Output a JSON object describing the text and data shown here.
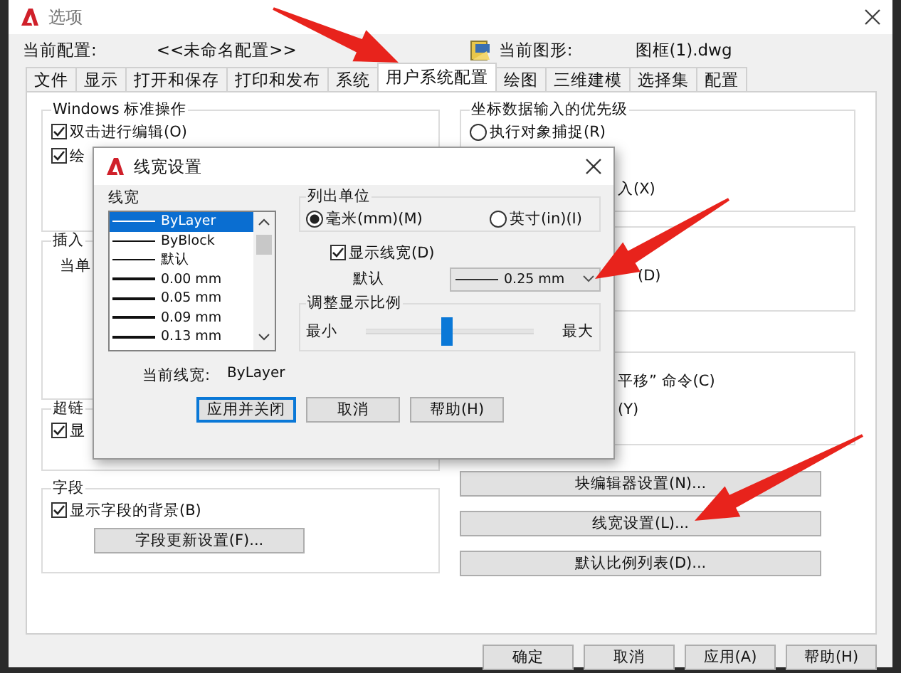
{
  "window": {
    "title": "选项"
  },
  "profile": {
    "label": "当前配置:",
    "value": "<<未命名配置>>"
  },
  "drawing": {
    "label": "当前图形:",
    "value": "图框(1).dwg"
  },
  "tabs": [
    {
      "label": "文件",
      "selected": false
    },
    {
      "label": "显示",
      "selected": false
    },
    {
      "label": "打开和保存",
      "selected": false
    },
    {
      "label": "打印和发布",
      "selected": false
    },
    {
      "label": "系统",
      "selected": false
    },
    {
      "label": "用户系统配置",
      "selected": true
    },
    {
      "label": "绘图",
      "selected": false
    },
    {
      "label": "三维建模",
      "selected": false
    },
    {
      "label": "选择集",
      "selected": false
    },
    {
      "label": "配置",
      "selected": false
    }
  ],
  "windows_group": {
    "title": "Windows 标准操作",
    "checkboxes": [
      {
        "label": "双击进行编辑(O)",
        "checked": true
      },
      {
        "label": "绘",
        "checked": true
      }
    ]
  },
  "insert_group": {
    "title": "插入",
    "label": "当单"
  },
  "hyperlink_group": {
    "title": "超链",
    "checkbox": {
      "label": "显",
      "checked": true
    }
  },
  "field_group": {
    "title": "字段",
    "checkbox": {
      "label": "显示字段的背景(B)",
      "checked": true
    },
    "button": "字段更新设置(F)..."
  },
  "coordinate_group": {
    "title": "坐标数据输入的优先级",
    "radio": {
      "label": "执行对象捕捉(R)",
      "selected": false
    },
    "text": "入(X)"
  },
  "group_2": {
    "text": "(D)"
  },
  "group_3": {
    "texts": [
      "平移” 命令(C)",
      "(Y)"
    ]
  },
  "right_buttons": [
    "块编辑器设置(N)...",
    "线宽设置(L)...",
    "默认比例列表(D)..."
  ],
  "buttons": [
    "确定",
    "取消",
    "应用(A)",
    "帮助(H)"
  ],
  "lineweight_dialog": {
    "title": "线宽设置",
    "list_label": "线宽",
    "items": [
      {
        "label": "ByLayer",
        "selected": true
      },
      {
        "label": "ByBlock",
        "selected": false
      },
      {
        "label": "默认",
        "selected": false
      },
      {
        "label": "0.00 mm",
        "selected": false
      },
      {
        "label": "0.05 mm",
        "selected": false
      },
      {
        "label": "0.09 mm",
        "selected": false
      },
      {
        "label": "0.13 mm",
        "selected": false
      }
    ],
    "units": {
      "title": "列出单位",
      "options": [
        {
          "label": "毫米(mm)(M)",
          "selected": true
        },
        {
          "label": "英寸(in)(I)",
          "selected": false
        }
      ]
    },
    "display": {
      "label": "显示线宽(D)",
      "checked": true
    },
    "default": {
      "label": "默认",
      "value": "0.25 mm"
    },
    "scale": {
      "title": "调整显示比例",
      "min": "最小",
      "max": "最大",
      "level": 0.48
    },
    "current": {
      "label": "当前线宽:",
      "value": "ByLayer"
    },
    "buttons": [
      "应用并关闭",
      "取消",
      "帮助(H)"
    ]
  }
}
